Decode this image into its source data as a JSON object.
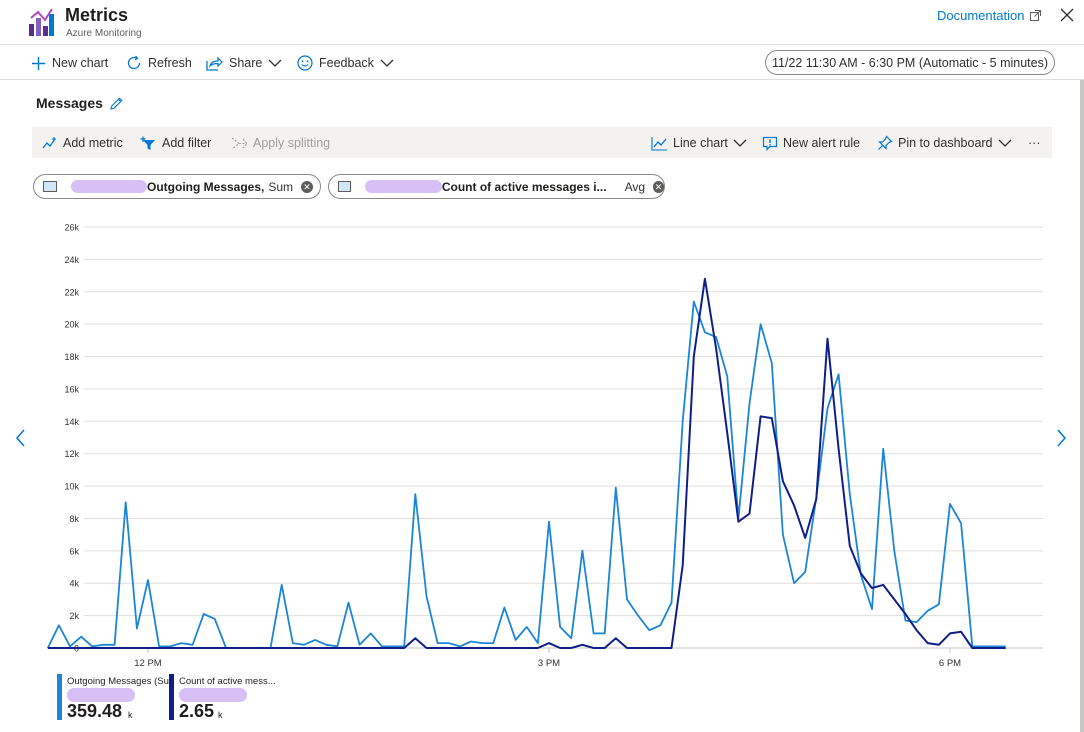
{
  "app": {
    "title": "Metrics",
    "subtitle": "Azure Monitoring",
    "documentation_label": "Documentation"
  },
  "toolbar": {
    "new_chart": "New chart",
    "refresh": "Refresh",
    "share": "Share",
    "feedback": "Feedback",
    "time_range": "11/22 11:30 AM - 6:30 PM (Automatic - 5 minutes)"
  },
  "chart_panel": {
    "title": "Messages",
    "add_metric": "Add metric",
    "add_filter": "Add filter",
    "apply_splitting": "Apply splitting",
    "chart_type": "Line chart",
    "new_alert_rule": "New alert rule",
    "pin_to_dashboard": "Pin to dashboard",
    "more": "···"
  },
  "metric_pills": [
    {
      "prefix": ",",
      "metric": "Outgoing Messages,",
      "aggregation": "Sum"
    },
    {
      "prefix": ",",
      "metric": "Count of active messages i...",
      "aggregation": "Avg"
    }
  ],
  "legend": [
    {
      "name": "Outgoing Messages (Sum)",
      "value": "359.48",
      "unit": "k"
    },
    {
      "name": "Count of active mess...",
      "value": "2.65",
      "unit": "k"
    }
  ],
  "colors": {
    "accent": "#0078d4",
    "series_outgoing": "#1a86d8",
    "series_active": "#0f1f8a",
    "gridline": "#e1dfdd",
    "blur": "#d8bff5"
  },
  "chart_data": {
    "type": "line",
    "ylim": [
      0,
      26000
    ],
    "yticks": [
      0,
      2000,
      4000,
      6000,
      8000,
      10000,
      12000,
      14000,
      16000,
      18000,
      20000,
      22000,
      24000,
      26000
    ],
    "ytick_labels": [
      "0",
      "2k",
      "4k",
      "6k",
      "8k",
      "10k",
      "12k",
      "14k",
      "16k",
      "18k",
      "20k",
      "22k",
      "24k",
      "26k"
    ],
    "xlim": [
      "11:30 AM",
      "6:30 PM"
    ],
    "xticks": [
      {
        "minutes_after_start": 30,
        "label": "12 PM"
      },
      {
        "minutes_after_start": 210,
        "label": "3 PM"
      },
      {
        "minutes_after_start": 390,
        "label": "6 PM"
      }
    ],
    "grid": true,
    "interval_minutes": 5,
    "series": [
      {
        "name": "Outgoing Messages (Sum)",
        "values": [
          0,
          1400,
          100,
          700,
          100,
          200,
          200,
          9000,
          1200,
          4200,
          100,
          100,
          300,
          200,
          2100,
          1800,
          0,
          0,
          0,
          0,
          0,
          3900,
          300,
          200,
          500,
          200,
          100,
          2800,
          200,
          900,
          100,
          100,
          100,
          9500,
          3200,
          300,
          300,
          100,
          400,
          300,
          300,
          2500,
          500,
          1300,
          300,
          7800,
          1300,
          600,
          6000,
          900,
          900,
          9900,
          3000,
          2000,
          1100,
          1400,
          2800,
          14000,
          21400,
          19500,
          19200,
          16800,
          8000,
          15100,
          20000,
          17600,
          7000,
          4000,
          4700,
          9300,
          14800,
          16900,
          9500,
          4500,
          2400,
          12300,
          6000,
          1700,
          1600,
          2300,
          2700,
          8900,
          7700,
          100,
          100,
          100,
          100
        ]
      },
      {
        "name": "Count of active mess...",
        "values": [
          0,
          0,
          0,
          0,
          0,
          0,
          0,
          0,
          0,
          0,
          0,
          0,
          0,
          0,
          0,
          0,
          0,
          0,
          0,
          0,
          0,
          0,
          0,
          0,
          0,
          0,
          0,
          0,
          0,
          0,
          0,
          0,
          0,
          600,
          0,
          0,
          0,
          0,
          0,
          0,
          0,
          0,
          0,
          0,
          0,
          300,
          0,
          0,
          200,
          0,
          0,
          600,
          0,
          0,
          0,
          0,
          0,
          5100,
          18000,
          22800,
          18500,
          13300,
          7800,
          8300,
          14300,
          14200,
          10300,
          8800,
          6800,
          9200,
          19100,
          12300,
          6300,
          4600,
          3700,
          3900,
          3000,
          2100,
          1100,
          300,
          200,
          900,
          1000,
          0,
          0,
          0,
          0
        ]
      }
    ]
  }
}
